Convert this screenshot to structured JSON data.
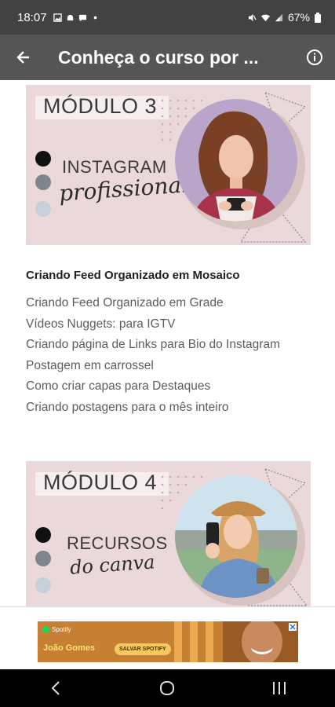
{
  "status_bar": {
    "time": "18:07",
    "battery": "67%",
    "left_icons": [
      "gallery-icon",
      "android-icon",
      "chat-icon",
      "dot-icon"
    ],
    "right_icons": [
      "mute-icon",
      "wifi-icon",
      "signal-icon",
      "battery-icon"
    ]
  },
  "app_bar": {
    "title": "Conheça o curso por ...",
    "back_icon": "arrow-left-icon",
    "info_icon": "info-icon"
  },
  "modules": [
    {
      "title": "MÓDULO 3",
      "word": "INSTAGRAM",
      "script": "profissional",
      "dot_colors": [
        "#111111",
        "#7c8590",
        "#c5d0db"
      ],
      "accent": "#ead8da"
    },
    {
      "title": "MÓDULO 4",
      "word": "RECURSOS",
      "script": "do canva",
      "dot_colors": [
        "#111111",
        "#7c8590",
        "#c5d0db"
      ],
      "accent": "#ead8da"
    }
  ],
  "lessons": {
    "heading": "Criando Feed Organizado em Mosaico",
    "items": [
      "Criando Feed Organizado em Grade",
      "Vídeos Nuggets: para IGTV",
      "Criando página de Links para Bio do Instagram",
      "Postagem em carrossel",
      "Como criar capas para Destaques",
      "Criando postagens para o mês inteiro"
    ]
  },
  "ad": {
    "brand": "Spotify",
    "artist": "João Gomes",
    "cta": "SALVAR SPOTIFY",
    "background": "#c67f33"
  },
  "nav_bar": {
    "icons": [
      "back-nav-icon",
      "home-nav-icon",
      "recents-nav-icon"
    ]
  }
}
